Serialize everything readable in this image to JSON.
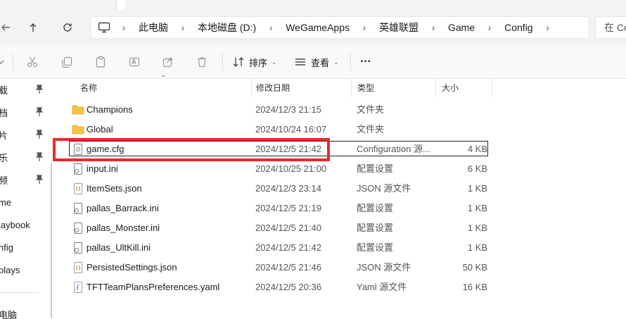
{
  "nav": {
    "breadcrumbs": [
      "此电脑",
      "本地磁盘 (D:)",
      "WeGameApps",
      "英雄联盟",
      "Game",
      "Config"
    ],
    "search_placeholder": "在 Co"
  },
  "toolbar": {
    "sort_label": "排序",
    "view_label": "查看",
    "more_label": "···"
  },
  "sidebar": {
    "items": [
      {
        "label": "载",
        "pinned": true
      },
      {
        "label": "档",
        "pinned": true
      },
      {
        "label": "片",
        "pinned": true
      },
      {
        "label": "乐",
        "pinned": true
      },
      {
        "label": "频",
        "pinned": true
      },
      {
        "label": "me",
        "pinned": false
      },
      {
        "label": "laybook",
        "pinned": false
      },
      {
        "label": "nfig",
        "pinned": false
      },
      {
        "label": "plays",
        "pinned": false
      },
      {
        "label": "电脑",
        "pinned": false
      }
    ]
  },
  "columns": {
    "name": "名称",
    "date": "修改日期",
    "type": "类型",
    "size": "大小"
  },
  "files": [
    {
      "name": "Champions",
      "date": "2024/12/3 21:15",
      "type": "文件夹",
      "size": "",
      "icon": "folder-icon"
    },
    {
      "name": "Global",
      "date": "2024/10/24 16:07",
      "type": "文件夹",
      "size": "",
      "icon": "folder-icon"
    },
    {
      "name": "game.cfg",
      "date": "2024/12/5 21:42",
      "type": "Configuration 源...",
      "size": "4 KB",
      "icon": "config-file-icon",
      "selected": true
    },
    {
      "name": "input.ini",
      "date": "2024/10/25 21:00",
      "type": "配置设置",
      "size": "6 KB",
      "icon": "ini-file-icon"
    },
    {
      "name": "ItemSets.json",
      "date": "2024/12/3 23:14",
      "type": "JSON 源文件",
      "size": "1 KB",
      "icon": "json-file-icon"
    },
    {
      "name": "pallas_Barrack.ini",
      "date": "2024/12/5 21:19",
      "type": "配置设置",
      "size": "1 KB",
      "icon": "ini-file-icon"
    },
    {
      "name": "pallas_Monster.ini",
      "date": "2024/12/5 21:40",
      "type": "配置设置",
      "size": "1 KB",
      "icon": "ini-file-icon"
    },
    {
      "name": "pallas_UltKill.ini",
      "date": "2024/12/5 21:42",
      "type": "配置设置",
      "size": "1 KB",
      "icon": "ini-file-icon"
    },
    {
      "name": "PersistedSettings.json",
      "date": "2024/12/5 21:46",
      "type": "JSON 源文件",
      "size": "50 KB",
      "icon": "json-file-icon"
    },
    {
      "name": "TFTTeamPlansPreferences.yaml",
      "date": "2024/12/5 20:36",
      "type": "Yaml 源文件",
      "size": "16 KB",
      "icon": "yaml-file-icon"
    }
  ],
  "colors": {
    "highlight": "#e82a2a",
    "folder": "#f6c443"
  }
}
